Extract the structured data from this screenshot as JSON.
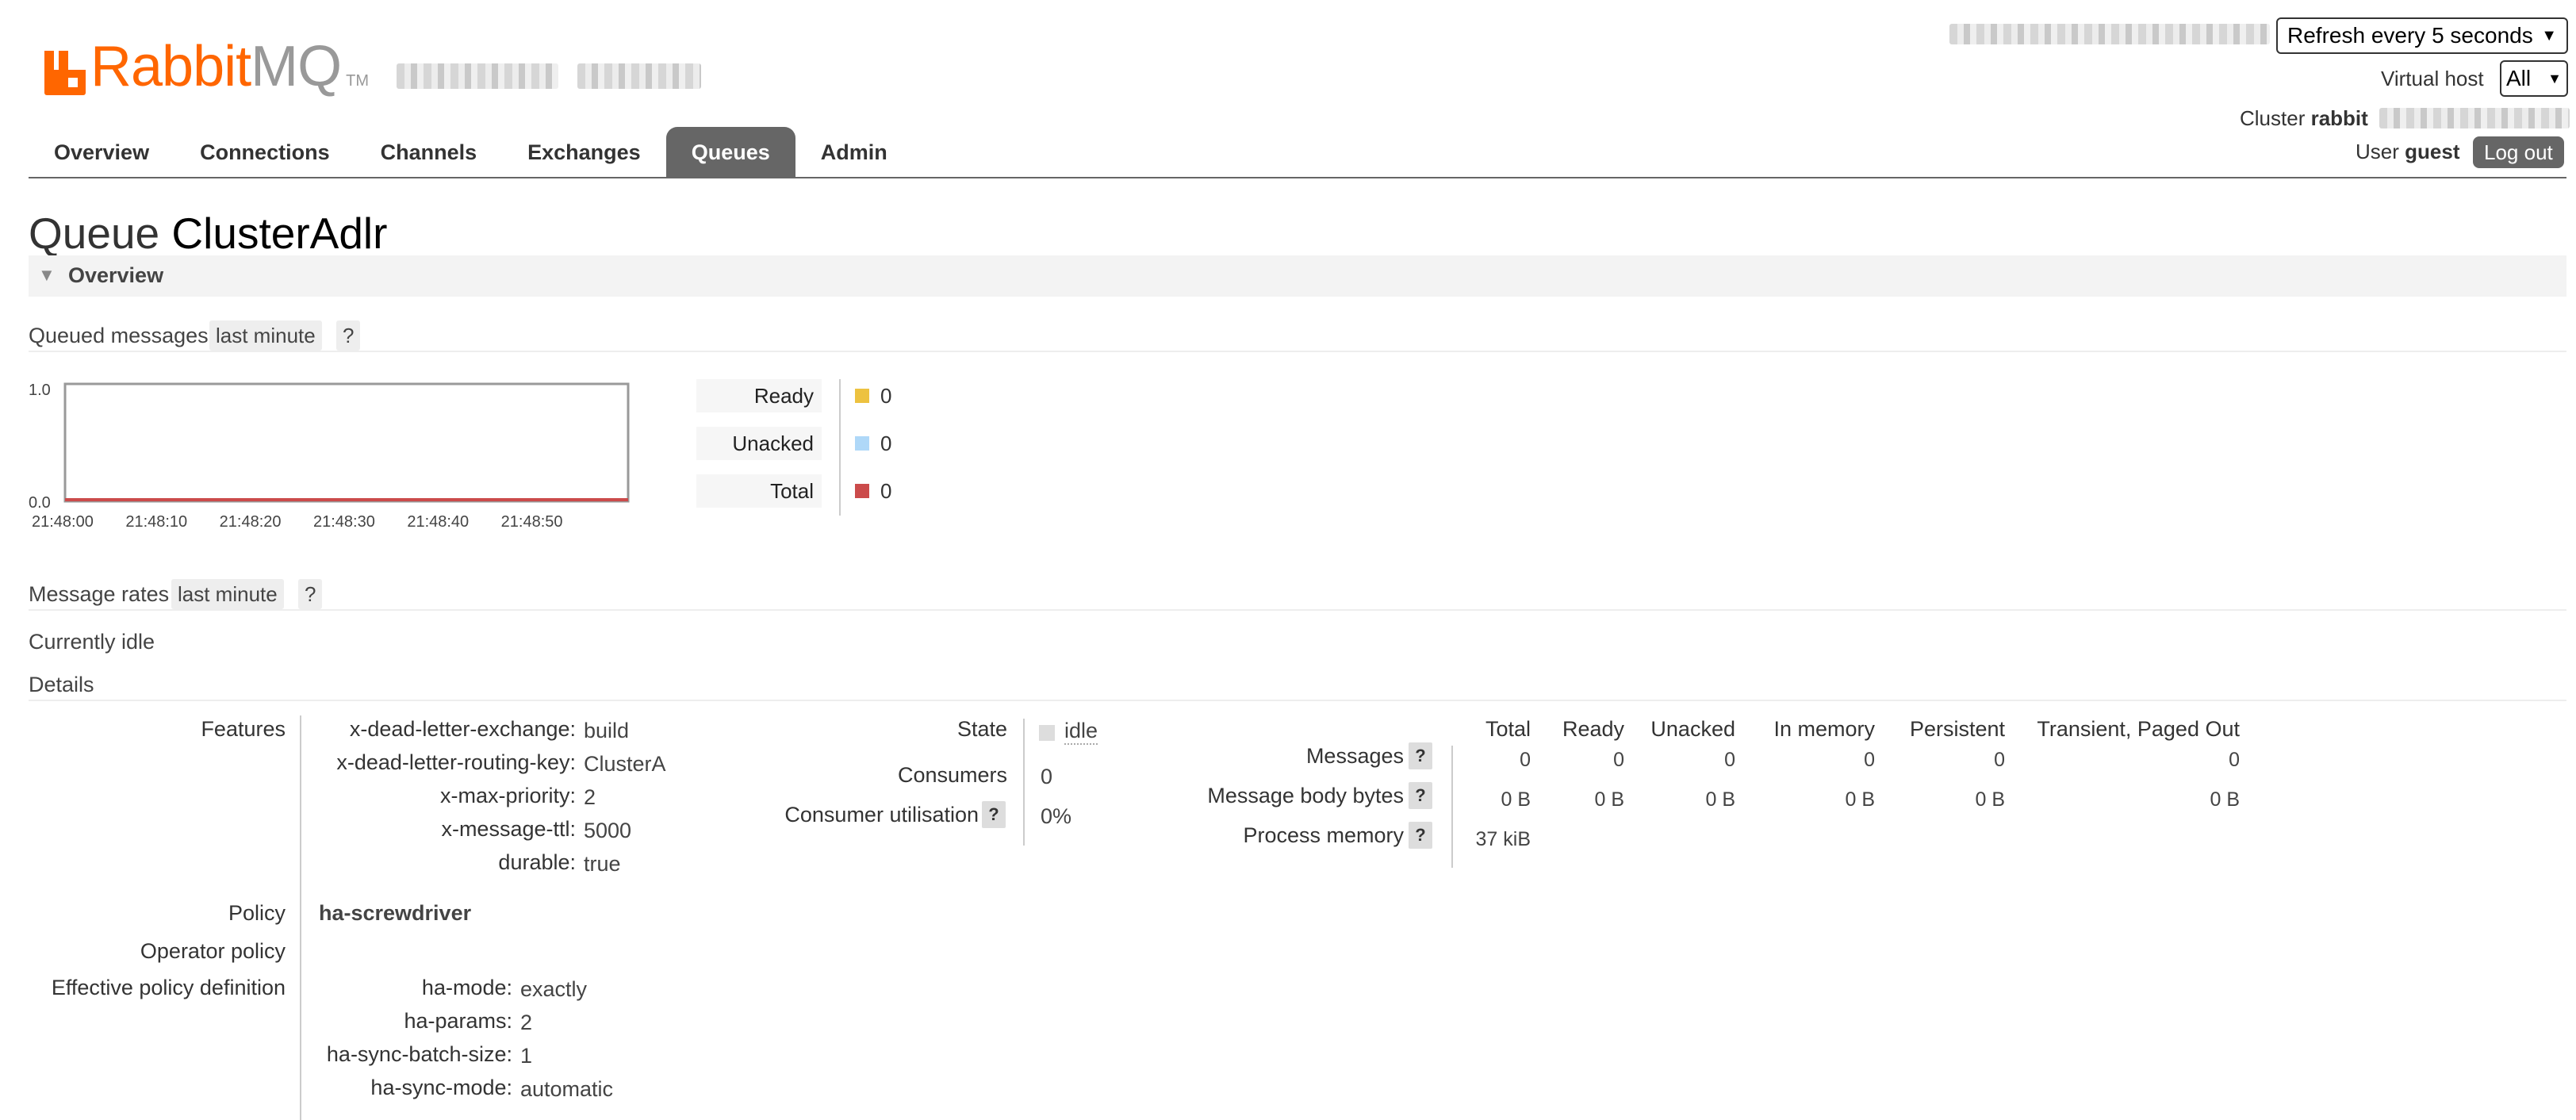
{
  "brand": {
    "name_rabbit": "Rabbit",
    "name_mq": "MQ",
    "tm": "TM"
  },
  "header": {
    "refresh_label": "Refresh every 5 seconds",
    "vhost_label": "Virtual host",
    "vhost_value": "All",
    "cluster_label": "Cluster",
    "cluster_name": "rabbit",
    "user_label": "User",
    "user_name": "guest",
    "logout": "Log out"
  },
  "tabs": [
    "Overview",
    "Connections",
    "Channels",
    "Exchanges",
    "Queues",
    "Admin"
  ],
  "active_tab": "Queues",
  "page": {
    "title_prefix": "Queue",
    "queue_name": "ClusterAdlr"
  },
  "overview": {
    "section_title": "Overview",
    "queued_messages_label": "Queued messages",
    "range": "last minute",
    "help": "?",
    "chart_data": {
      "type": "line",
      "x": [
        "21:48:00",
        "21:48:10",
        "21:48:20",
        "21:48:30",
        "21:48:40",
        "21:48:50"
      ],
      "ylim": [
        0.0,
        1.0
      ],
      "y_ticks": [
        "1.0",
        "0.0"
      ],
      "series": [
        {
          "name": "Ready",
          "color": "#edc240",
          "values": [
            0,
            0,
            0,
            0,
            0,
            0
          ]
        },
        {
          "name": "Unacked",
          "color": "#afd8f8",
          "values": [
            0,
            0,
            0,
            0,
            0,
            0
          ]
        },
        {
          "name": "Total",
          "color": "#cb4b4b",
          "values": [
            0,
            0,
            0,
            0,
            0,
            0
          ]
        }
      ]
    },
    "legend": [
      {
        "label": "Ready",
        "value": "0",
        "color": "#edc240"
      },
      {
        "label": "Unacked",
        "value": "0",
        "color": "#afd8f8"
      },
      {
        "label": "Total",
        "value": "0",
        "color": "#cb4b4b"
      }
    ],
    "message_rates_label": "Message rates",
    "currently_idle": "Currently idle",
    "details_label": "Details"
  },
  "details": {
    "features_label": "Features",
    "features": [
      {
        "key": "x-dead-letter-exchange:",
        "value": "build"
      },
      {
        "key": "x-dead-letter-routing-key:",
        "value": "ClusterA"
      },
      {
        "key": "x-max-priority:",
        "value": "2"
      },
      {
        "key": "x-message-ttl:",
        "value": "5000"
      },
      {
        "key": "durable:",
        "value": "true"
      }
    ],
    "policy_label": "Policy",
    "policy_value": "ha-screwdriver",
    "operator_policy_label": "Operator policy",
    "effective_policy_label": "Effective policy definition",
    "effective_policy": [
      {
        "key": "ha-mode:",
        "value": "exactly"
      },
      {
        "key": "ha-params:",
        "value": "2"
      },
      {
        "key": "ha-sync-batch-size:",
        "value": "1"
      },
      {
        "key": "ha-sync-mode:",
        "value": "automatic"
      }
    ],
    "state_label": "State",
    "state_value": "idle",
    "consumers_label": "Consumers",
    "consumers_value": "0",
    "utilisation_label": "Consumer utilisation",
    "utilisation_value": "0%",
    "stats_headers": [
      "Total",
      "Ready",
      "Unacked",
      "In memory",
      "Persistent",
      "Transient, Paged Out"
    ],
    "stats_rows": [
      {
        "label": "Messages",
        "values": [
          "0",
          "0",
          "0",
          "0",
          "0",
          "0"
        ]
      },
      {
        "label": "Message body bytes",
        "values": [
          "0 B",
          "0 B",
          "0 B",
          "0 B",
          "0 B",
          "0 B"
        ]
      },
      {
        "label": "Process memory",
        "values": [
          "37 kiB"
        ]
      }
    ]
  }
}
